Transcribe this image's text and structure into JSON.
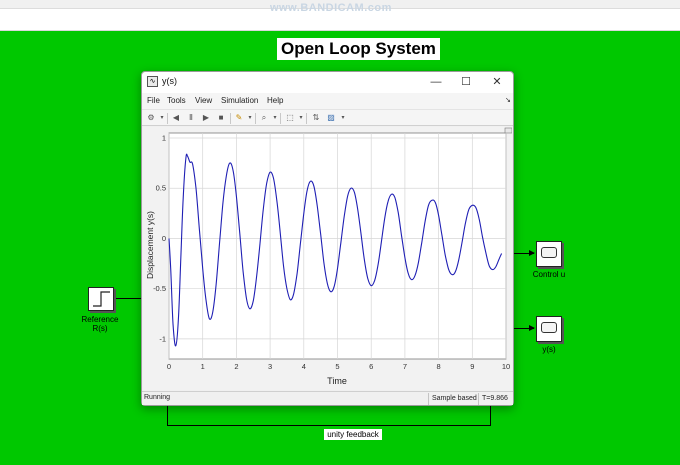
{
  "screen_watermark": "www.BANDICAM.com",
  "diagram": {
    "title": "Open Loop System",
    "blocks": {
      "reference_label_1": "Reference",
      "reference_label_2": "R(s)",
      "control_label": "Control u",
      "output_label": "y(s)",
      "feedback_label": "unity feedback"
    },
    "canvas_color": "#00c800"
  },
  "scope_window": {
    "title": "y(s)",
    "controls": {
      "minimize": "—",
      "maximize": "☐",
      "close": "✕"
    },
    "menu": [
      "File",
      "Tools",
      "View",
      "Simulation",
      "Help"
    ],
    "toolbar_icons": [
      "settings-icon",
      "step-back-icon",
      "pause-icon",
      "step-forward-icon",
      "stop-icon",
      "highlight-icon",
      "zoom-icon",
      "fit-icon",
      "cursor-measure-icon",
      "style-icon"
    ],
    "status": {
      "state": "Running",
      "mode": "Sample based",
      "time": "T=9.866"
    }
  },
  "chart_data": {
    "type": "line",
    "title": "",
    "xlabel": "Time",
    "ylabel": "Displacement y(s)",
    "xlim": [
      0,
      10
    ],
    "ylim": [
      -1.2,
      1.05
    ],
    "xticks": [
      "0",
      "1",
      "2",
      "3",
      "4",
      "5",
      "6",
      "7",
      "8",
      "9",
      "10"
    ],
    "yticks": [
      "-1",
      "-0.5",
      "0",
      "0.5",
      "1"
    ],
    "grid": true,
    "series_color": "#1f1fb4",
    "series": [
      {
        "x": [
          0,
          0.05,
          0.12,
          0.2,
          0.28,
          0.35,
          0.42,
          0.5,
          0.55,
          0.62,
          0.7,
          0.8,
          0.9,
          1.0,
          1.1,
          1.2,
          1.3,
          1.4,
          1.5,
          1.6,
          1.7,
          1.8,
          1.9,
          2.0,
          2.1,
          2.2,
          2.3,
          2.4,
          2.5,
          2.6,
          2.7,
          2.8,
          2.9,
          3.0,
          3.1,
          3.2,
          3.3,
          3.4,
          3.5,
          3.6,
          3.7,
          3.8,
          3.9,
          4.0,
          4.1,
          4.2,
          4.3,
          4.4,
          4.5,
          4.6,
          4.7,
          4.8,
          4.9,
          5.0,
          5.1,
          5.2,
          5.3,
          5.4,
          5.5,
          5.6,
          5.7,
          5.8,
          5.9,
          6.0,
          6.1,
          6.2,
          6.3,
          6.4,
          6.5,
          6.6,
          6.7,
          6.8,
          6.9,
          7.0,
          7.1,
          7.2,
          7.3,
          7.4,
          7.5,
          7.6,
          7.7,
          7.8,
          7.9,
          8.0,
          8.1,
          8.2,
          8.3,
          8.4,
          8.5,
          8.6,
          8.7,
          8.8,
          8.9,
          9.0,
          9.1,
          9.2,
          9.3,
          9.4,
          9.5,
          9.6,
          9.7,
          9.8,
          9.87
        ],
        "y": [
          0,
          -0.3,
          -0.85,
          -1.07,
          -0.8,
          -0.2,
          0.4,
          0.8,
          0.82,
          0.76,
          0.74,
          0.5,
          0.1,
          -0.3,
          -0.62,
          -0.8,
          -0.73,
          -0.45,
          -0.05,
          0.35,
          0.62,
          0.75,
          0.68,
          0.42,
          0.05,
          -0.33,
          -0.6,
          -0.7,
          -0.62,
          -0.38,
          -0.05,
          0.3,
          0.55,
          0.66,
          0.6,
          0.38,
          0.06,
          -0.28,
          -0.5,
          -0.61,
          -0.55,
          -0.35,
          -0.05,
          0.25,
          0.48,
          0.57,
          0.52,
          0.32,
          0.04,
          -0.25,
          -0.45,
          -0.53,
          -0.48,
          -0.3,
          -0.04,
          0.22,
          0.42,
          0.5,
          0.46,
          0.29,
          0.04,
          -0.22,
          -0.4,
          -0.47,
          -0.42,
          -0.27,
          -0.04,
          0.2,
          0.37,
          0.44,
          0.41,
          0.26,
          0.03,
          -0.19,
          -0.35,
          -0.41,
          -0.37,
          -0.24,
          -0.04,
          0.17,
          0.33,
          0.38,
          0.36,
          0.23,
          0.03,
          -0.17,
          -0.31,
          -0.36,
          -0.33,
          -0.21,
          -0.03,
          0.16,
          0.29,
          0.33,
          0.31,
          0.2,
          0.02,
          -0.14,
          -0.27,
          -0.31,
          -0.28,
          -0.2,
          -0.15
        ]
      }
    ]
  }
}
